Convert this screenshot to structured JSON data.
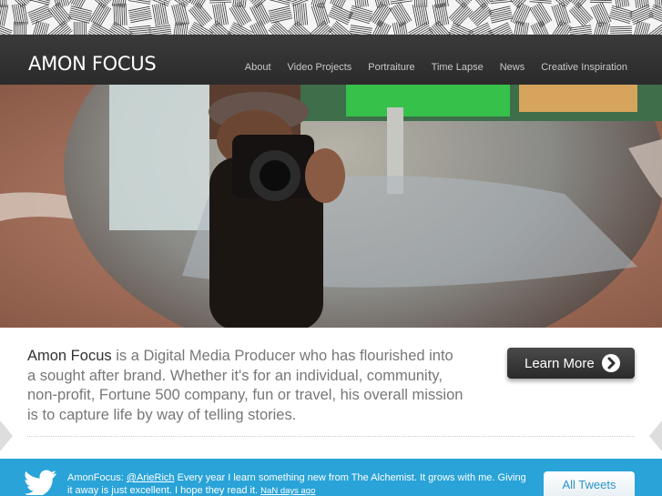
{
  "header": {
    "logo": "AMON FOCUS",
    "nav": [
      "About",
      "Video Projects",
      "Portraiture",
      "Time Lapse",
      "News",
      "Creative Inspiration"
    ]
  },
  "hero": {
    "image": "photographer-reflection-in-sunglasses"
  },
  "intro": {
    "brand": "Amon Focus",
    "text": " is a Digital Media Producer who has flourished into a sought after brand. Whether it's for an individual, community, non-profit, Fortune 500 company, fun or travel, his overall mission is to capture life by way of telling stories.",
    "button_label": "Learn More"
  },
  "tweet": {
    "author": "AmonFocus: ",
    "mention": "@ArieRich",
    "text": " Every year I learn something new from The Alchemist. It grows with me. Giving it away is just excellent. I hope they read it. ",
    "time": "NaN days ago",
    "button_label": "All Tweets"
  },
  "colors": {
    "header_bg": "#2b2b2b",
    "tweet_bar": "#29a3d8",
    "intro_text": "#777777",
    "button_dark": "#333333"
  },
  "icons": [
    "twitter-bird-icon",
    "chevron-right-icon"
  ]
}
